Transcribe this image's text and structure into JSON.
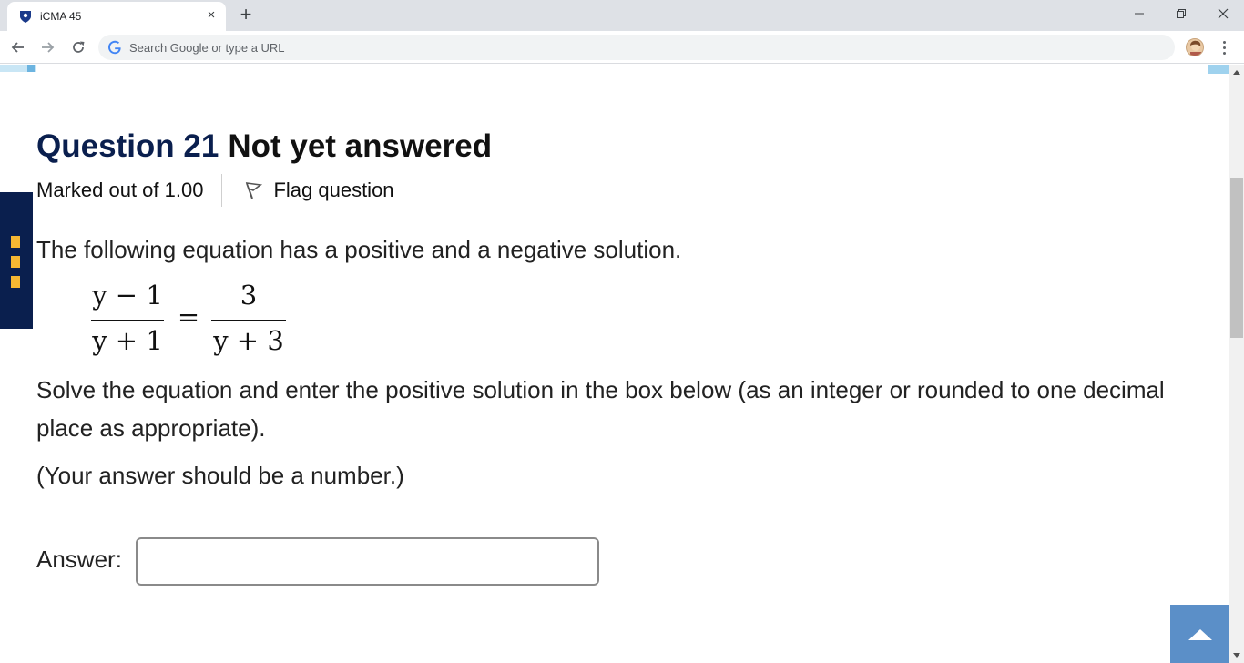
{
  "browser": {
    "tab_title": "iCMA 45",
    "new_tab_symbol": "+",
    "close_symbol": "×",
    "omnibox_placeholder": "Search Google or type a URL",
    "icons": [
      "shield-icon",
      "close-icon",
      "plus-icon",
      "minimize-icon",
      "restore-icon",
      "window-close-icon",
      "back-arrow-icon",
      "forward-arrow-icon",
      "reload-icon",
      "google-g-icon",
      "profile-avatar",
      "kebab-menu-icon"
    ]
  },
  "question": {
    "number_label": "Question 21",
    "status": "Not yet answered",
    "marked_out_of": "Marked out of 1.00",
    "flag_label": "Flag question",
    "intro": "The following equation has a positive and a negative solution.",
    "equation": {
      "left_numerator": "y − 1",
      "left_denominator": "y + 1",
      "equals": "=",
      "right_numerator": "3",
      "right_denominator": "y + 3"
    },
    "instruction": "Solve the equation and enter the positive solution in the box below (as an integer or rounded to one decimal place as appropriate).",
    "note": "(Your answer should be a number.)",
    "answer_label": "Answer:",
    "answer_value": ""
  },
  "colors": {
    "heading_blue": "#0a1f4e",
    "side_nav_bg": "#0a1f4e",
    "side_nav_marker": "#f5b733",
    "to_top_button": "#5b8fc8"
  }
}
